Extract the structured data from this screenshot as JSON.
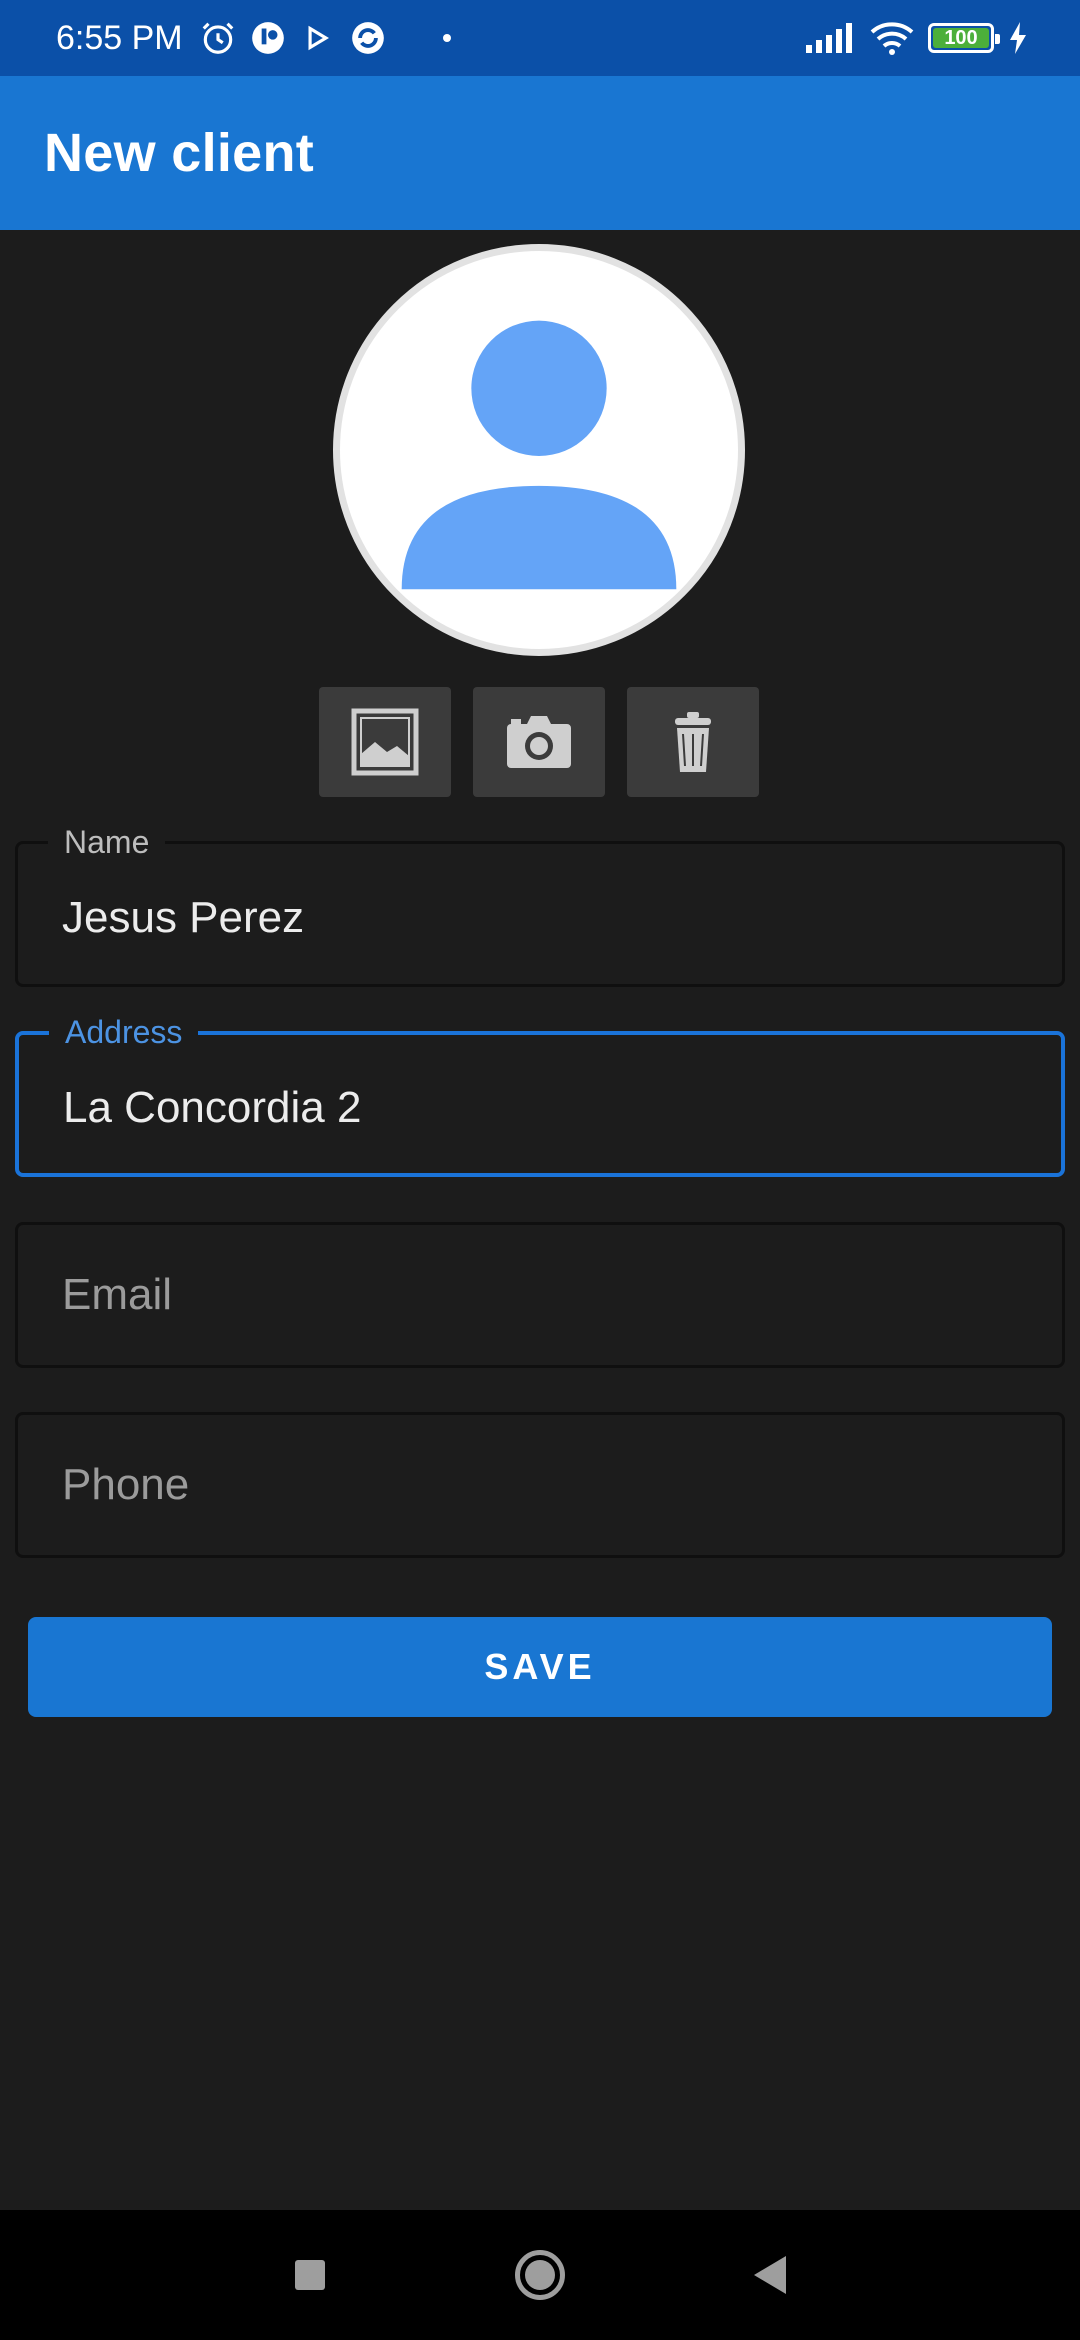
{
  "status_bar": {
    "time": "6:55 PM",
    "battery": "100",
    "icons": [
      "alarm-icon",
      "app-notification-icon",
      "play-icon",
      "sync-icon",
      "signal-icon",
      "wifi-icon",
      "battery-icon",
      "charging-icon"
    ]
  },
  "app_bar": {
    "title": "New client"
  },
  "avatar": {
    "icon": "person-placeholder-icon",
    "color": "#64a4f7"
  },
  "image_actions": [
    {
      "icon": "gallery-icon"
    },
    {
      "icon": "camera-icon"
    },
    {
      "icon": "trash-icon"
    }
  ],
  "form": {
    "name": {
      "label": "Name",
      "value": "Jesus Perez"
    },
    "address": {
      "label": "Address",
      "value": "La Concordia 2"
    },
    "email": {
      "placeholder": "Email"
    },
    "phone": {
      "placeholder": "Phone"
    }
  },
  "save_label": "SAVE",
  "colors": {
    "primary": "#1976d2",
    "status_bar": "#0b50a8",
    "background": "#1c1c1c",
    "focus": "#1a73d9"
  },
  "nav_bar": {
    "icons": [
      "recents-icon",
      "home-icon",
      "back-icon"
    ]
  }
}
